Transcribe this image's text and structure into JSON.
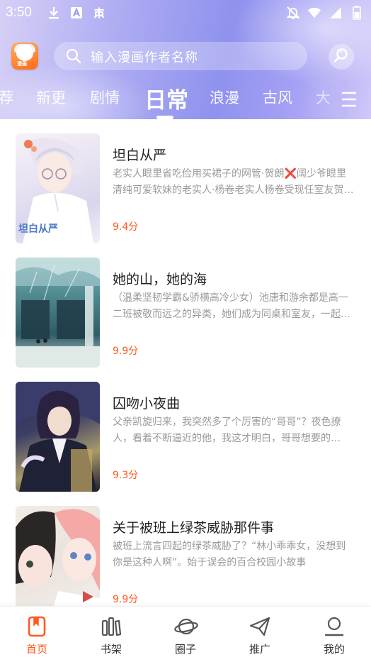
{
  "status_bar": {
    "time": "3:50",
    "left_icons": [
      "download-icon",
      "a-letter-icon",
      "app-notification-icon"
    ],
    "right_icons": [
      "mute-bell-icon",
      "wifi-icon",
      "signal-icon",
      "battery-icon"
    ]
  },
  "header": {
    "logo_icon": "app-logo",
    "logo_tag": "漫画",
    "search": {
      "placeholder": "输入漫画作者名称"
    },
    "search_button_icon": "search-icon"
  },
  "tabs": [
    {
      "label": "荐",
      "active": false
    },
    {
      "label": "新更",
      "active": false
    },
    {
      "label": "剧情",
      "active": false
    },
    {
      "label": "日常",
      "active": true
    },
    {
      "label": "浪漫",
      "active": false
    },
    {
      "label": "古风",
      "active": false
    },
    {
      "label": "大",
      "active": false
    }
  ],
  "tab_menu_icon": "menu-icon",
  "comics": [
    {
      "title": "坦白从严",
      "description": "老实人眼里省吃俭用买裙子的网管·贺朗❌阔少爷眼里清纯可爱软妹的老实人·杨卷老实人杨卷受现任室友贺朗的欺骗……",
      "score": "9.4分",
      "cover_text": "坦白从严"
    },
    {
      "title": "她的山，她的海",
      "description": "（温柔坚韧学霸&骄横高冷少女）池唐和游余都是高一二班被敬而远之的异类，她们成为同桌和室友，一起度过了……",
      "score": "9.9分",
      "cover_text": ""
    },
    {
      "title": "囚吻小夜曲",
      "description": "父亲凯旋归来，我突然多了个厉害的“哥哥”？夜色撩人，看着不断逼近的他，我这才明白，哥哥想要的是……",
      "score": "9.3分",
      "cover_text": ""
    },
    {
      "title": "关于被班上绿茶威胁那件事",
      "description": "被班上流言四起的绿茶威胁了？“林小乖乖女，没想到你是这种人啊”。始于误会的百合校园小故事",
      "score": "9.9分",
      "cover_text": ""
    }
  ],
  "bottom_nav": [
    {
      "label": "首页",
      "icon": "home-bookmark-icon",
      "active": true
    },
    {
      "label": "书架",
      "icon": "bookshelf-icon",
      "active": false
    },
    {
      "label": "圈子",
      "icon": "planet-icon",
      "active": false
    },
    {
      "label": "推广",
      "icon": "paper-plane-icon",
      "active": false
    },
    {
      "label": "我的",
      "icon": "profile-icon",
      "active": false
    }
  ],
  "colors": {
    "accent": "#ff5a1f",
    "header_gradient": [
      "#d6d0f6",
      "#8f92ee",
      "#cfc8f8"
    ],
    "desc_text": "#9a9a9a"
  }
}
